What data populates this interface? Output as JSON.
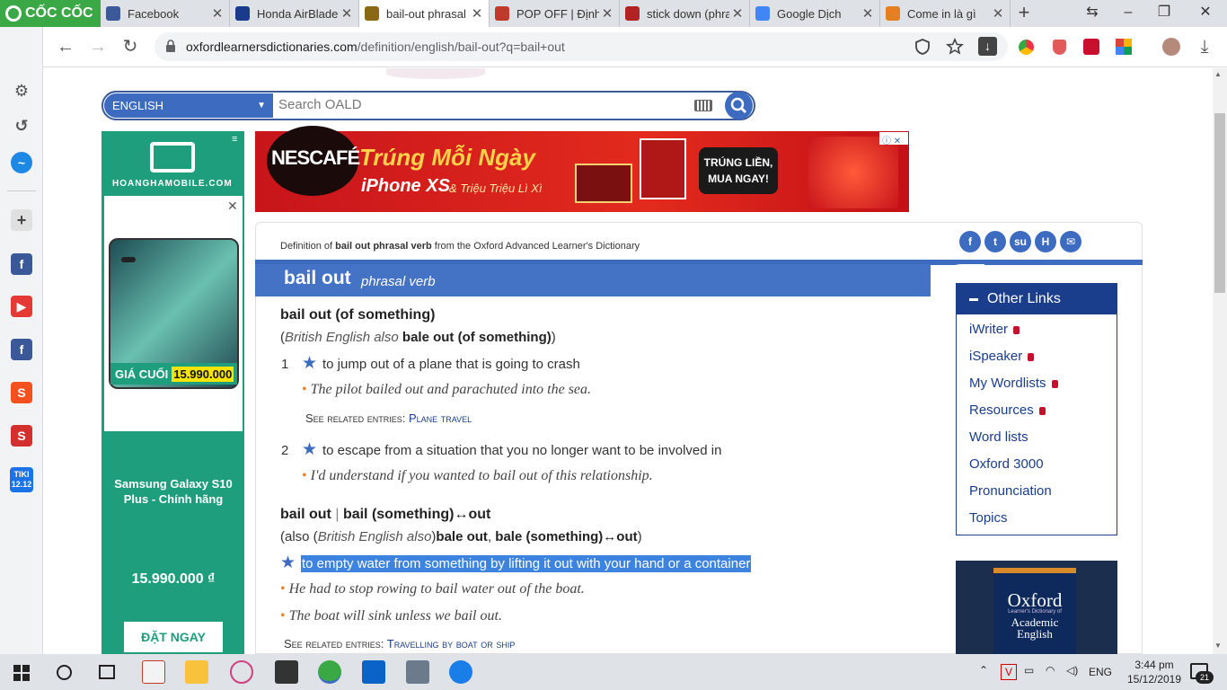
{
  "browser": {
    "brand": "CỐC CỐC",
    "tabs": [
      {
        "label": "Facebook",
        "color": "#3b5998",
        "active": false
      },
      {
        "label": "Honda AirBlade",
        "color": "#1a3a8c",
        "active": false
      },
      {
        "label": "bail-out phrasal",
        "color": "#8b6914",
        "active": true
      },
      {
        "label": "POP OFF | Định n",
        "color": "#c0392b",
        "active": false
      },
      {
        "label": "stick down (phra",
        "color": "#b22222",
        "active": false
      },
      {
        "label": "Google Dịch",
        "color": "#4285f4",
        "active": false
      },
      {
        "label": "Come in là gì",
        "color": "#e67e22",
        "active": false
      }
    ],
    "url_host": "oxfordlearnersdictionaries.com",
    "url_path": "/definition/english/bail-out?q=bail+out"
  },
  "search": {
    "dictionary": "ENGLISH",
    "placeholder": "Search OALD"
  },
  "left_ad": {
    "brand": "HOANGHAMOBILE.COM",
    "price_label": "GIÁ CUỐI",
    "price_tag": "15.990.000",
    "product": "Samsung Galaxy S10 Plus - Chính hãng",
    "price": "15.990.000 ₫",
    "button": "ĐẶT NGAY"
  },
  "top_ad": {
    "brand": "NESCAFÉ",
    "headline": "Trúng Mỗi Ngày",
    "sub1": "iPhone XS",
    "sub2": "& Triệu Triệu Lì Xì",
    "cta": "TRÚNG LIỀN, MUA NGAY!"
  },
  "entry": {
    "definition_of_prefix": "Definition of ",
    "definition_of_term": "bail out phrasal verb",
    "definition_of_suffix": " from the Oxford Advanced Learner's Dictionary",
    "headword": "bail out",
    "pos": "phrasal verb",
    "sense_group1": {
      "form": "bail out (of something)",
      "variant_open": "(",
      "variant_label": "British English also",
      "variant_form": "bale out (of something)",
      "variant_close": ")",
      "senses": [
        {
          "num": "1",
          "def": "to jump out of a plane that is going to crash",
          "examples": [
            "The pilot bailed out and parachuted into the sea."
          ],
          "see_also_label": "See related entries:",
          "see_also_link": "Plane travel"
        },
        {
          "num": "2",
          "def": "to escape from a situation that you no longer want to be involved in",
          "examples": [
            "I'd understand if you wanted to bail out of this relationship."
          ]
        }
      ]
    },
    "sense_group2": {
      "form_a": "bail out",
      "sep": " | ",
      "form_b": "bail (something)↔out",
      "also_open": "(also (",
      "also_label": "British English also",
      "also_close": ")",
      "also_form1": "bale out",
      "also_comma": ", ",
      "also_form2": "bale (something)↔out",
      "also_end": ")",
      "def": "to empty water from something by lifting it out with your hand or a container",
      "examples": [
        "He had to stop rowing to bail water out of the boat.",
        "The boat will sink unless we bail out."
      ],
      "see_also_label": "See related entries:",
      "see_also_link": "Travelling by boat or ship"
    }
  },
  "other_links": {
    "title": "Other Links",
    "items": [
      {
        "label": "iWriter",
        "locked": true
      },
      {
        "label": "iSpeaker",
        "locked": true
      },
      {
        "label": "My Wordlists",
        "locked": true
      },
      {
        "label": "Resources",
        "locked": true
      },
      {
        "label": "Word lists",
        "locked": false
      },
      {
        "label": "Oxford 3000",
        "locked": false
      },
      {
        "label": "Pronunciation",
        "locked": false
      },
      {
        "label": "Topics",
        "locked": false
      }
    ]
  },
  "book": {
    "title": "Oxford",
    "subtitle": "Academic English",
    "tag": "Learner's Dictionary of"
  },
  "taskbar": {
    "language": "ENG",
    "time": "3:44 pm",
    "date": "15/12/2019",
    "notifications": "21"
  },
  "colors": {
    "oxford_blue": "#4472c4",
    "oxford_dark": "#1a3d8c",
    "highlight": "#3d83e0",
    "ad_green": "#1e9e7c"
  }
}
